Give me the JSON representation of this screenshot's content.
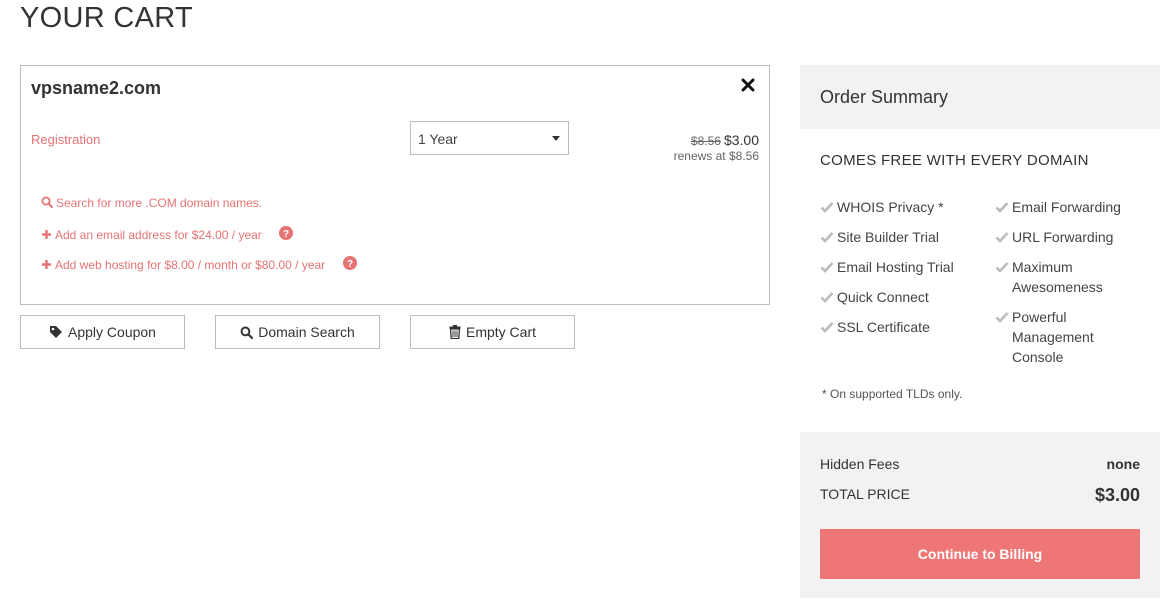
{
  "page": {
    "title": "YOUR CART"
  },
  "cart_item": {
    "domain": "vpsname2.com",
    "registration_label": "Registration",
    "term_selected": "1 Year",
    "old_price": "$8.56",
    "price": "$3.00",
    "renews": "renews at $8.56",
    "links": {
      "search": "Search for more .COM domain names.",
      "email": "Add an email address for $24.00 / year",
      "hosting": "Add web hosting for $8.00 / month or $80.00 / year"
    }
  },
  "actions": {
    "apply_coupon": "Apply Coupon",
    "domain_search": "Domain Search",
    "empty_cart": "Empty Cart"
  },
  "summary": {
    "title": "Order Summary",
    "free_title": "COMES FREE WITH EVERY DOMAIN",
    "features_left": [
      "WHOIS Privacy *",
      "Site Builder Trial",
      "Email Hosting Trial",
      "Quick Connect",
      "SSL Certificate"
    ],
    "features_right": [
      "Email Forwarding",
      "URL Forwarding",
      "Maximum Awesomeness",
      "Powerful Management Console"
    ],
    "footnote": "* On supported TLDs only.",
    "hidden_fees_label": "Hidden Fees",
    "hidden_fees_value": "none",
    "total_label": "TOTAL PRICE",
    "total_value": "$3.00",
    "continue_label": "Continue to Billing"
  },
  "colors": {
    "accent": "#ef7676",
    "link": "#e57373",
    "panel": "#f2f2f2",
    "check": "#bbbbbb"
  },
  "icons": [
    "close-icon",
    "search-icon",
    "plus-icon",
    "help-icon",
    "tag-icon",
    "trash-icon",
    "check-icon",
    "chevron-down-icon"
  ]
}
